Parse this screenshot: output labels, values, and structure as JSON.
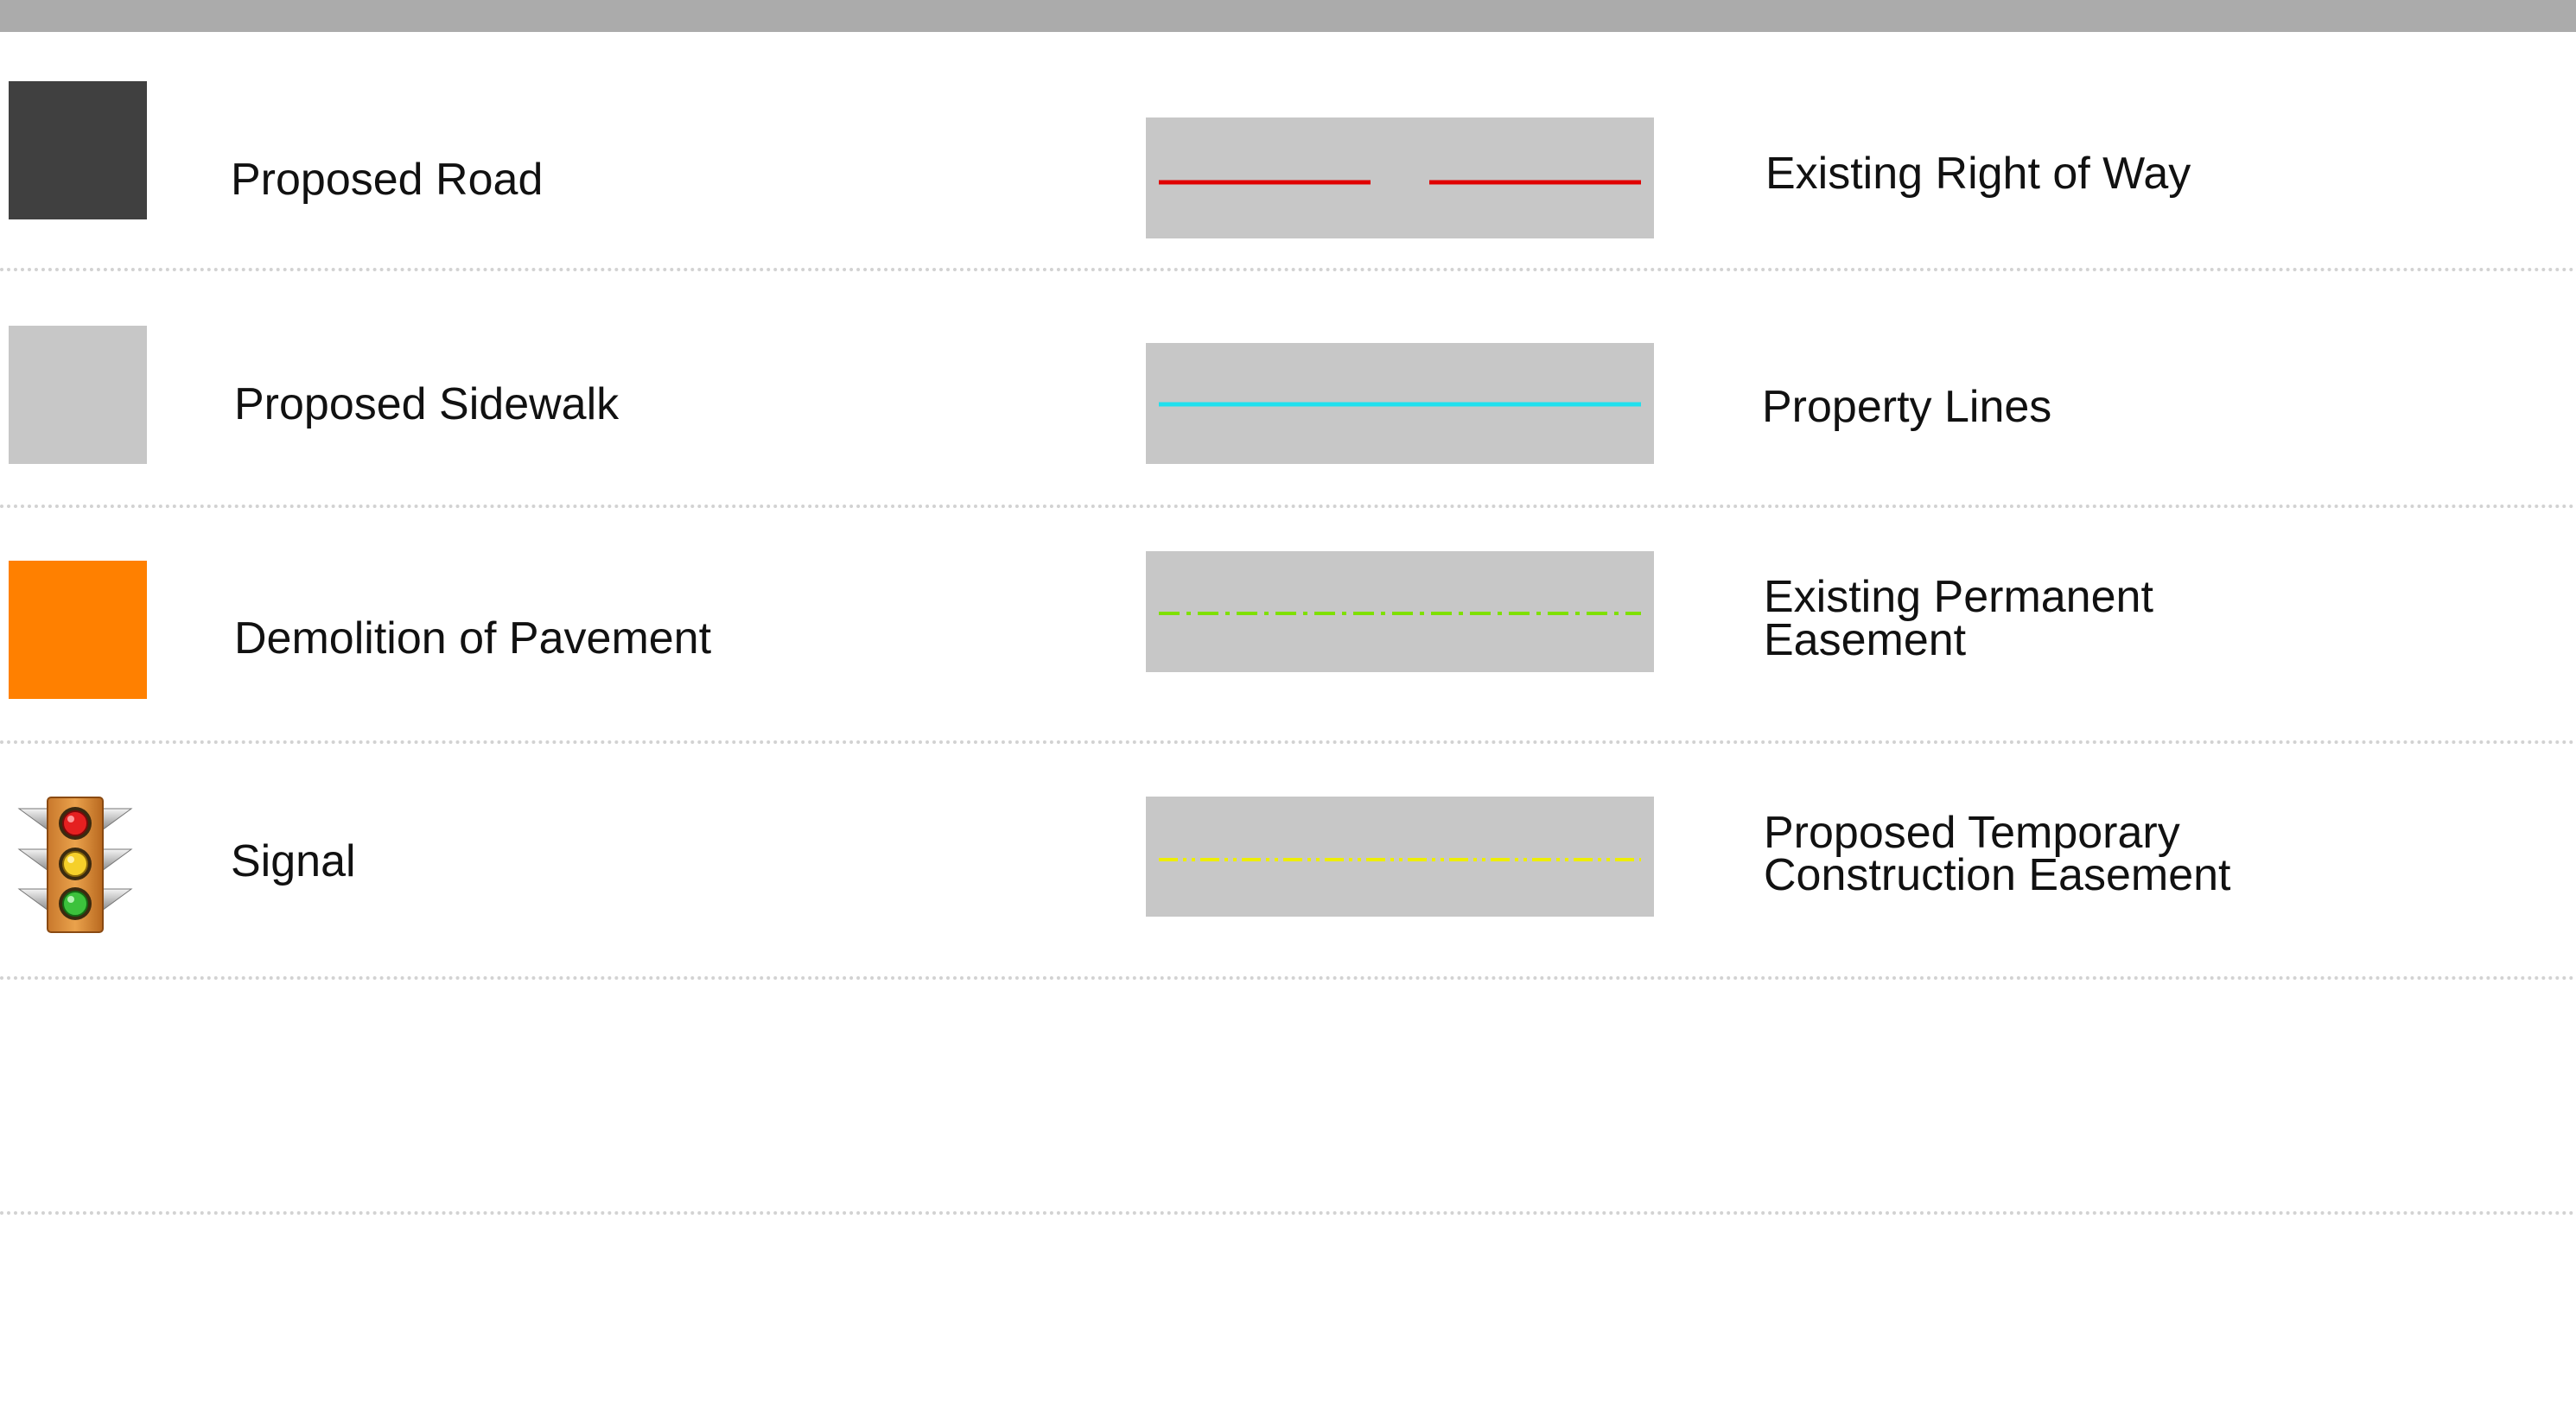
{
  "legend": {
    "left_items": [
      {
        "label": "Proposed Road",
        "symbol": "dark-gray-fill-swatch",
        "color": "#404040"
      },
      {
        "label": "Proposed Sidewalk",
        "symbol": "light-gray-fill-swatch",
        "color": "#c7c7c7"
      },
      {
        "label": "Demolition of Pavement",
        "symbol": "orange-fill-swatch",
        "color": "#ff8000"
      },
      {
        "label": "Signal",
        "symbol": "traffic-signal-icon"
      }
    ],
    "right_items": [
      {
        "label_lines": [
          "Existing Right of Way"
        ],
        "line_style": "dashed",
        "color": "#e00000"
      },
      {
        "label_lines": [
          "Property Lines"
        ],
        "line_style": "solid",
        "color": "#20e0ee"
      },
      {
        "label_lines": [
          "Existing Permanent",
          "Easement"
        ],
        "line_style": "dash-dot",
        "color": "#7fe000"
      },
      {
        "label_lines": [
          "Proposed Temporary",
          "Construction Easement"
        ],
        "line_style": "dash-dot-dot",
        "color": "#eeee00"
      }
    ]
  }
}
